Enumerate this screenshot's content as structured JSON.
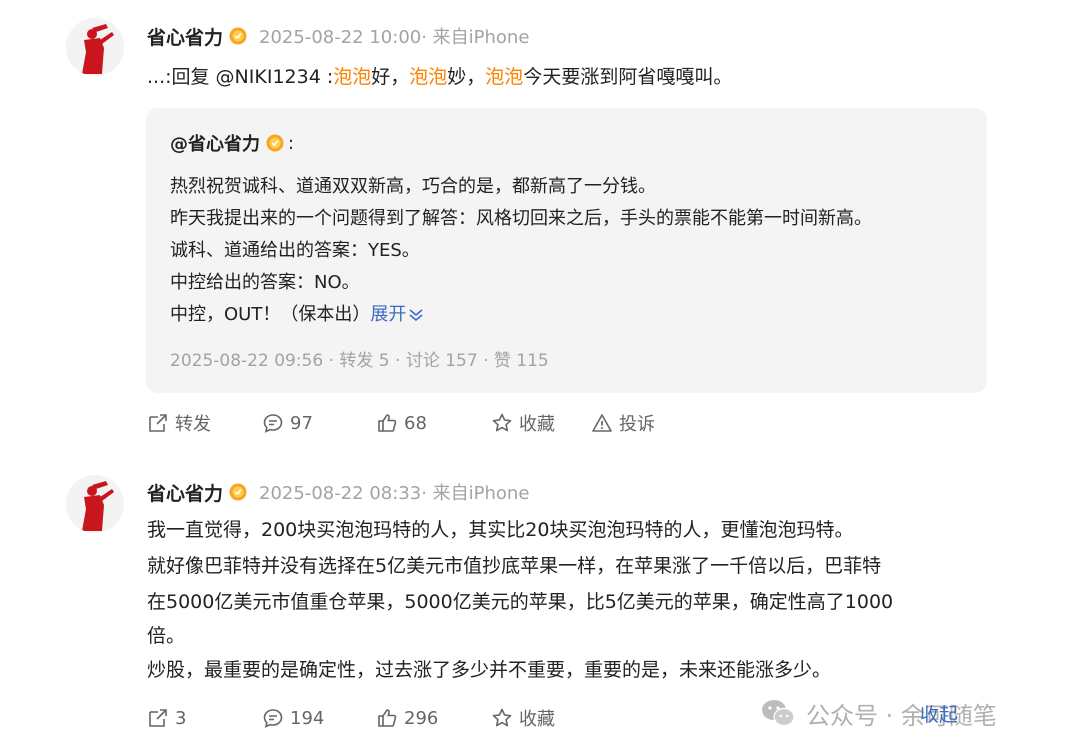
{
  "posts": [
    {
      "author": "省心省力",
      "meta": "2025-08-22 10:00· 来自iPhone",
      "content": {
        "prefix": "...:回复 @NIKI1234 :",
        "hl1": "泡泡",
        "mid1": "好，",
        "hl2": "泡泡",
        "mid2": "妙，",
        "hl3": "泡泡",
        "suffix": "今天要涨到阿省嘎嘎叫。"
      },
      "quote": {
        "author": "@省心省力",
        "colon": ":",
        "lines": [
          "热烈祝贺诚科、道通双双新高，巧合的是，都新高了一分钱。",
          "昨天我提出来的一个问题得到了解答：风格切回来之后，手头的票能不能第一时间新高。",
          "诚科、道通给出的答案：YES。",
          "中控给出的答案：NO。",
          "中控，OUT！（保本出）"
        ],
        "expand_label": "展开",
        "footer": "2025-08-22 09:56 · 转发 5 · 讨论 157 · 赞 115"
      },
      "actions": {
        "repost": "转发",
        "comment": "97",
        "like": "68",
        "favorite": "收藏",
        "report": "投诉"
      }
    },
    {
      "author": "省心省力",
      "meta": "2025-08-22 08:33· 来自iPhone",
      "lines": [
        "我一直觉得，200块买泡泡玛特的人，其实比20块买泡泡玛特的人，更懂泡泡玛特。",
        "就好像巴菲特并没有选择在5亿美元市值抄底苹果一样，在苹果涨了一千倍以后，巴菲特",
        "在5000亿美元市值重仓苹果，5000亿美元的苹果，比5亿美元的苹果，确定性高了1000",
        "倍。",
        "炒股，最重要的是确定性，过去涨了多少并不重要，重要的是，未来还能涨多少。"
      ],
      "actions": {
        "repost": "3",
        "comment": "194",
        "like": "296",
        "favorite": "收藏"
      },
      "collapse_label": "收起"
    }
  ],
  "watermark": "公众号 · 余可随笔",
  "colors": {
    "highlight": "#ff8200",
    "link": "#3b6bc3",
    "muted": "#a3a3a3",
    "quote_bg": "#f4f4f4"
  },
  "icons": [
    "avatar-archer-figure",
    "verified-badge-icon",
    "repost-icon",
    "comment-icon",
    "like-icon",
    "favorite-icon",
    "report-icon",
    "chevron-down-icon",
    "wechat-icon"
  ]
}
